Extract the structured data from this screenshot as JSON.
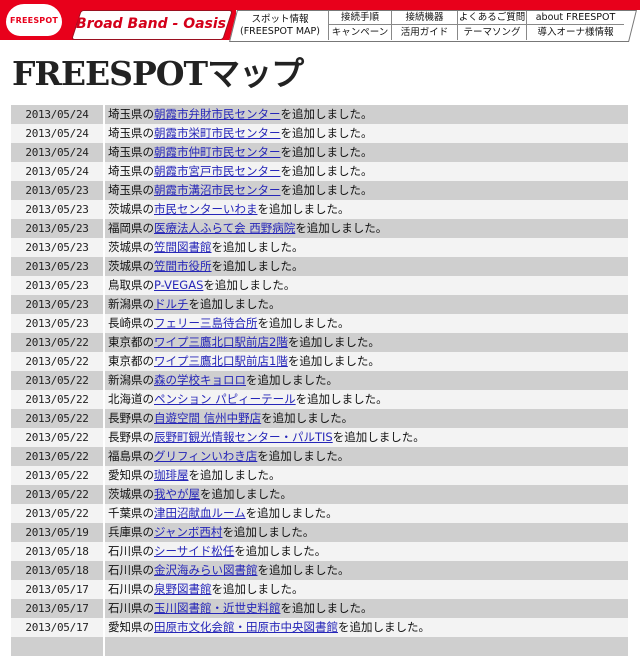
{
  "header": {
    "logo": "FREESPOT",
    "brand": "Broad Band - Oasis",
    "colors": {
      "brand_red": "#e8001b",
      "link_blue": "#2626b8",
      "row_dark": "#cfcfcf",
      "row_light": "#f3f3f3"
    },
    "nav": [
      {
        "line1": "スポット情報",
        "line2": "(FREESPOT MAP)"
      },
      {
        "top": "接続手順",
        "bottom": "キャンペーン"
      },
      {
        "top": "接続機器",
        "bottom": "活用ガイド"
      },
      {
        "top": "よくあるご質問",
        "bottom": "テーマソング"
      },
      {
        "top": "about FREESPOT",
        "bottom": "導入オーナ様情報"
      }
    ]
  },
  "page_title": "FREESPOTマップ",
  "entries": [
    {
      "date": "2013/05/24",
      "prefix": "埼玉県の",
      "link": "朝霞市弁財市民センター",
      "suffix": "を追加しました。"
    },
    {
      "date": "2013/05/24",
      "prefix": "埼玉県の",
      "link": "朝霞市栄町市民センター",
      "suffix": "を追加しました。"
    },
    {
      "date": "2013/05/24",
      "prefix": "埼玉県の",
      "link": "朝霞市仲町市民センター",
      "suffix": "を追加しました。"
    },
    {
      "date": "2013/05/24",
      "prefix": "埼玉県の",
      "link": "朝霞市宮戸市民センター",
      "suffix": "を追加しました。"
    },
    {
      "date": "2013/05/23",
      "prefix": "埼玉県の",
      "link": "朝霞市溝沼市民センター",
      "suffix": "を追加しました。"
    },
    {
      "date": "2013/05/23",
      "prefix": "茨城県の",
      "link": "市民センターいわま",
      "suffix": "を追加しました。"
    },
    {
      "date": "2013/05/23",
      "prefix": "福岡県の",
      "link": "医療法人ふらて会 西野病院",
      "suffix": "を追加しました。"
    },
    {
      "date": "2013/05/23",
      "prefix": "茨城県の",
      "link": "笠間図書館",
      "suffix": "を追加しました。"
    },
    {
      "date": "2013/05/23",
      "prefix": "茨城県の",
      "link": "笠間市役所",
      "suffix": "を追加しました。"
    },
    {
      "date": "2013/05/23",
      "prefix": "鳥取県の",
      "link": "P-VEGAS",
      "suffix": "を追加しました。"
    },
    {
      "date": "2013/05/23",
      "prefix": "新潟県の",
      "link": "ドルチ",
      "suffix": "を追加しました。"
    },
    {
      "date": "2013/05/23",
      "prefix": "長崎県の",
      "link": "フェリー三島待合所",
      "suffix": "を追加しました。"
    },
    {
      "date": "2013/05/22",
      "prefix": "東京都の",
      "link": "ワイプ三鷹北口駅前店2階",
      "suffix": "を追加しました。"
    },
    {
      "date": "2013/05/22",
      "prefix": "東京都の",
      "link": "ワイプ三鷹北口駅前店1階",
      "suffix": "を追加しました。"
    },
    {
      "date": "2013/05/22",
      "prefix": "新潟県の",
      "link": "森の学校キョロロ",
      "suffix": "を追加しました。"
    },
    {
      "date": "2013/05/22",
      "prefix": "北海道の",
      "link": "ペンション パピィーテール",
      "suffix": "を追加しました。"
    },
    {
      "date": "2013/05/22",
      "prefix": "長野県の",
      "link": "自遊空間 信州中野店",
      "suffix": "を追加しました。"
    },
    {
      "date": "2013/05/22",
      "prefix": "長野県の",
      "link": "辰野町観光情報センター・パルTIS",
      "suffix": "を追加しました。"
    },
    {
      "date": "2013/05/22",
      "prefix": "福島県の",
      "link": "グリフィンいわき店",
      "suffix": "を追加しました。"
    },
    {
      "date": "2013/05/22",
      "prefix": "愛知県の",
      "link": "珈琲屋",
      "suffix": "を追加しました。"
    },
    {
      "date": "2013/05/22",
      "prefix": "茨城県の",
      "link": "我やが屋",
      "suffix": "を追加しました。"
    },
    {
      "date": "2013/05/22",
      "prefix": "千葉県の",
      "link": "津田沼献血ルーム",
      "suffix": "を追加しました。"
    },
    {
      "date": "2013/05/19",
      "prefix": "兵庫県の",
      "link": "ジャンボ西村",
      "suffix": "を追加しました。"
    },
    {
      "date": "2013/05/18",
      "prefix": "石川県の",
      "link": "シーサイド松任",
      "suffix": "を追加しました。"
    },
    {
      "date": "2013/05/18",
      "prefix": "石川県の",
      "link": "金沢海みらい図書館",
      "suffix": "を追加しました。"
    },
    {
      "date": "2013/05/17",
      "prefix": "石川県の",
      "link": "泉野図書館",
      "suffix": "を追加しました。"
    },
    {
      "date": "2013/05/17",
      "prefix": "石川県の",
      "link": "玉川図書館・近世史料館",
      "suffix": "を追加しました。"
    },
    {
      "date": "2013/05/17",
      "prefix": "愛知県の",
      "link": "田原市文化会館・田原市中央図書館",
      "suffix": "を追加しました。"
    },
    {
      "date": "",
      "prefix": "",
      "link": "",
      "suffix": ""
    }
  ]
}
